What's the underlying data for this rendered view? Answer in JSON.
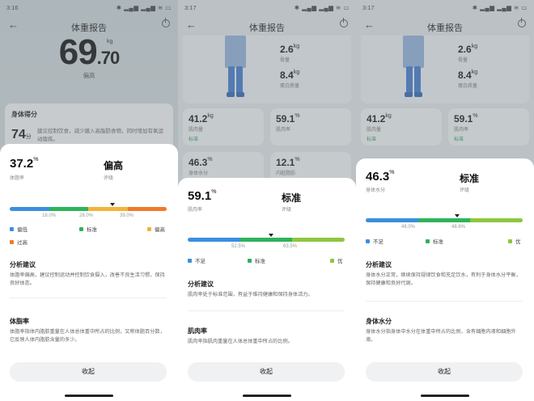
{
  "panels": [
    {
      "status": {
        "time": "3:16",
        "icons": "✱ ▂▄▆ ▂▄▆ ≋ ▭"
      },
      "title": "体重报告",
      "weight": {
        "value": "69",
        "decimal": ".70",
        "unit": "kg",
        "status": "偏高"
      },
      "score": {
        "title": "身体得分",
        "value": "74",
        "unit": "分",
        "desc": "建议控制饮食，减少摄入高脂肪食物，同时增加有氧运动锻炼。"
      },
      "sheet": {
        "value": "37.2",
        "unit": "%",
        "label": "体脂率",
        "status": "偏高",
        "status_label": "评级",
        "ticks": [
          "18.0%",
          "28.0%",
          "39.0%"
        ],
        "progress": 0.72,
        "legend": [
          "偏低",
          "标准",
          "偏高",
          "过高"
        ],
        "h1": "分析建议",
        "t1": "体脂率偏高，建议控制运动并控制饮食摄入，改善不良生活习惯，保持良好体态。",
        "h2": "体脂率",
        "t2": "体脂率指体内脂肪重量在人体总体重中所占的比例，又称体脂百分数，它反映人体内脂肪含量的多少。",
        "close": "收起"
      }
    },
    {
      "status": {
        "time": "3:17",
        "icons": "✱ ▂▄▆ ▂▄▆ ≋ ▭"
      },
      "title": "体重报告",
      "side": [
        {
          "v": "2.6",
          "u": "kg",
          "l": "骨量"
        },
        {
          "v": "8.4",
          "u": "kg",
          "l": "蛋白质量"
        }
      ],
      "tiles": [
        {
          "v": "41.2",
          "u": "kg",
          "l": "肌肉量",
          "tag": "标准"
        },
        {
          "v": "59.1",
          "u": "%",
          "l": "肌肉率",
          "tag": ""
        },
        {
          "v": "46.3",
          "u": "%",
          "l": "身体水分",
          "tag": ""
        },
        {
          "v": "12.1",
          "u": "%",
          "l": "内脏脂肪",
          "tag": ""
        }
      ],
      "sheet": {
        "value": "59.1",
        "unit": "%",
        "label": "肌肉率",
        "status": "标准",
        "status_label": "评级",
        "ticks": [
          "52.5%",
          "63.5%"
        ],
        "progress": 0.53,
        "legend": [
          "不足",
          "标准",
          "优"
        ],
        "h1": "分析建议",
        "t1": "肌肉率处于标准范围，有益于维持健康和保持身体活力。",
        "h2": "肌肉率",
        "t2": "肌肉率指肌肉重量在人体总体重中所占的比例。",
        "close": "收起"
      }
    },
    {
      "status": {
        "time": "3:17",
        "icons": "✱ ▂▄▆ ▂▄▆ ≋ ▭"
      },
      "title": "体重报告",
      "side": [
        {
          "v": "2.6",
          "u": "kg",
          "l": "骨量"
        },
        {
          "v": "8.4",
          "u": "kg",
          "l": "蛋白质量"
        }
      ],
      "tiles": [
        {
          "v": "41.2",
          "u": "kg",
          "l": "肌肉量",
          "tag": "标准"
        },
        {
          "v": "59.1",
          "u": "%",
          "l": "肌肉率",
          "tag": "标准"
        }
      ],
      "sheet": {
        "value": "46.3",
        "unit": "%",
        "label": "身体水分",
        "status": "标准",
        "status_label": "评级",
        "ticks": [
          "48.0%",
          "48.6%"
        ],
        "progress": 0.59,
        "legend": [
          "不足",
          "标准",
          "优"
        ],
        "h1": "分析建议",
        "t1": "身体水分正常，继续保持规律饮食和充足饮水，有利于身体水分平衡，保持健康和良好代谢。",
        "h2": "身体水分",
        "t2": "身体水分指身体中水分在体重中所占的比例，含有细胞内液和细胞外液。",
        "close": "收起"
      }
    }
  ],
  "colors": {
    "blue": "#3b8fde",
    "green": "#2eb35a",
    "yellow": "#f2b43a",
    "orange": "#f07a2a",
    "lime": "#8dc63f"
  }
}
